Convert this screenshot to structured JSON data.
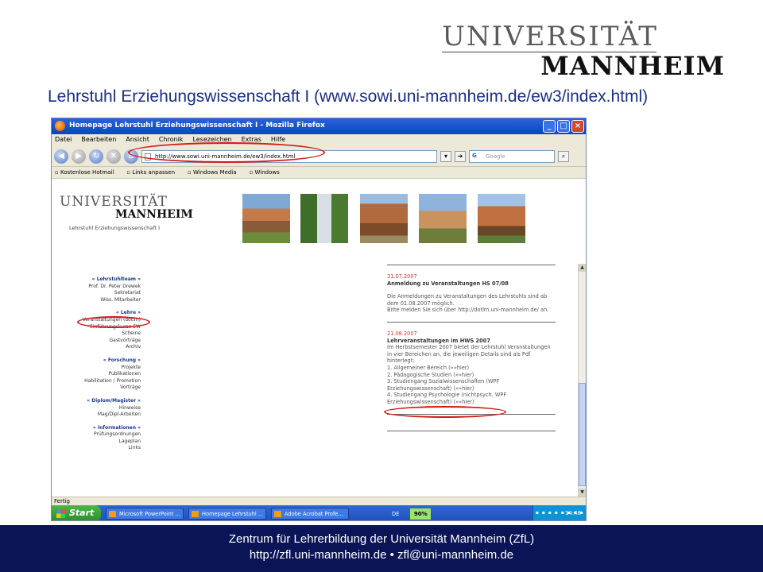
{
  "slide": {
    "logo_line1": "UNIVERSITÄT",
    "logo_line2": "MANNHEIM",
    "title": "Lehrstuhl Erziehungswissenschaft I (www.sowi.uni-mannheim.de/ew3/index.html)",
    "footer_line1": "Zentrum für Lehrerbildung der Universität Mannheim (ZfL)",
    "footer_line2": "http://zfl.uni-mannheim.de • zfl@uni-mannheim.de"
  },
  "browser": {
    "window_title": "Homepage Lehrstuhl Erziehungswissenschaft I - Mozilla Firefox",
    "menu": [
      "Datei",
      "Bearbeiten",
      "Ansicht",
      "Chronik",
      "Lesezeichen",
      "Extras",
      "Hilfe"
    ],
    "url": "http://www.sowi.uni-mannheim.de/ew3/index.html",
    "search_placeholder": "Google",
    "bookmarks": [
      "Kostenlose Hotmail",
      "Links anpassen",
      "Windows Media",
      "Windows"
    ],
    "status": "Fertig",
    "accent_color": "#0a46c2"
  },
  "site": {
    "logo_line1": "UNIVERSITÄT",
    "logo_line2": "MANNHEIM",
    "subtitle": "Lehrstuhl Erziehungswissenschaft I",
    "nav": [
      {
        "head": "« Lehrstuhlteam »",
        "items": [
          "Prof. Dr. Peter Drewek",
          "Sekretariat",
          "Wiss. Mitarbeiter"
        ]
      },
      {
        "head": "« Lehre »",
        "items": [
          "Veranstaltungen (dotlm)",
          "Einführungskurse EW",
          "Scheine",
          "Gastvorträge",
          "Archiv"
        ]
      },
      {
        "head": "« Forschung »",
        "items": [
          "Projekte",
          "Publikationen",
          "Habilitation / Promotion",
          "Vorträge"
        ]
      },
      {
        "head": "« Diplom/Magister »",
        "items": [
          "Hinweise",
          "Mag/Dipl-Arbeiten"
        ]
      },
      {
        "head": "« Informationen »",
        "items": [
          "Prüfungsordnungen",
          "Lageplan",
          "Links"
        ]
      }
    ],
    "news": [
      {
        "date": "31.07.2007",
        "head": "Anmeldung zu Veranstaltungen HS 07/08",
        "para1": "Die Anmeldungen zu Veranstaltungen des Lehrstuhls sind ab dem 01.08.2007 möglich.",
        "para2": "Bitte melden Sie sich über http://dotlm.uni-mannheim.de/ an."
      },
      {
        "date": "21.08.2007",
        "head": "Lehrveranstaltungen im HWS 2007",
        "body": "Im Herbstsemester 2007 bietet der Lehrstuhl Veranstaltungen in vier Bereichen an, die jeweiligen Details sind als Pdf hinterlegt:",
        "items": [
          "1. Allgemeiner Bereich (»»hier)",
          "2. Pädagogische Studien (»»hier)",
          "3. Studiengang Sozialwissenschaften (WPF Erziehungswissenschaft) (»»hier)",
          "4. Studiengang Psychologie (nichtpsych. WPF Erziehungswissenschaft) (»»hier)"
        ]
      }
    ]
  },
  "taskbar": {
    "start": "Start",
    "tasks": [
      "Microsoft PowerPoint ...",
      "Homepage Lehrstuhl ...",
      "Adobe Acrobat Profe..."
    ],
    "lang": "DE",
    "battery": "90%",
    "clock": "14:48"
  }
}
